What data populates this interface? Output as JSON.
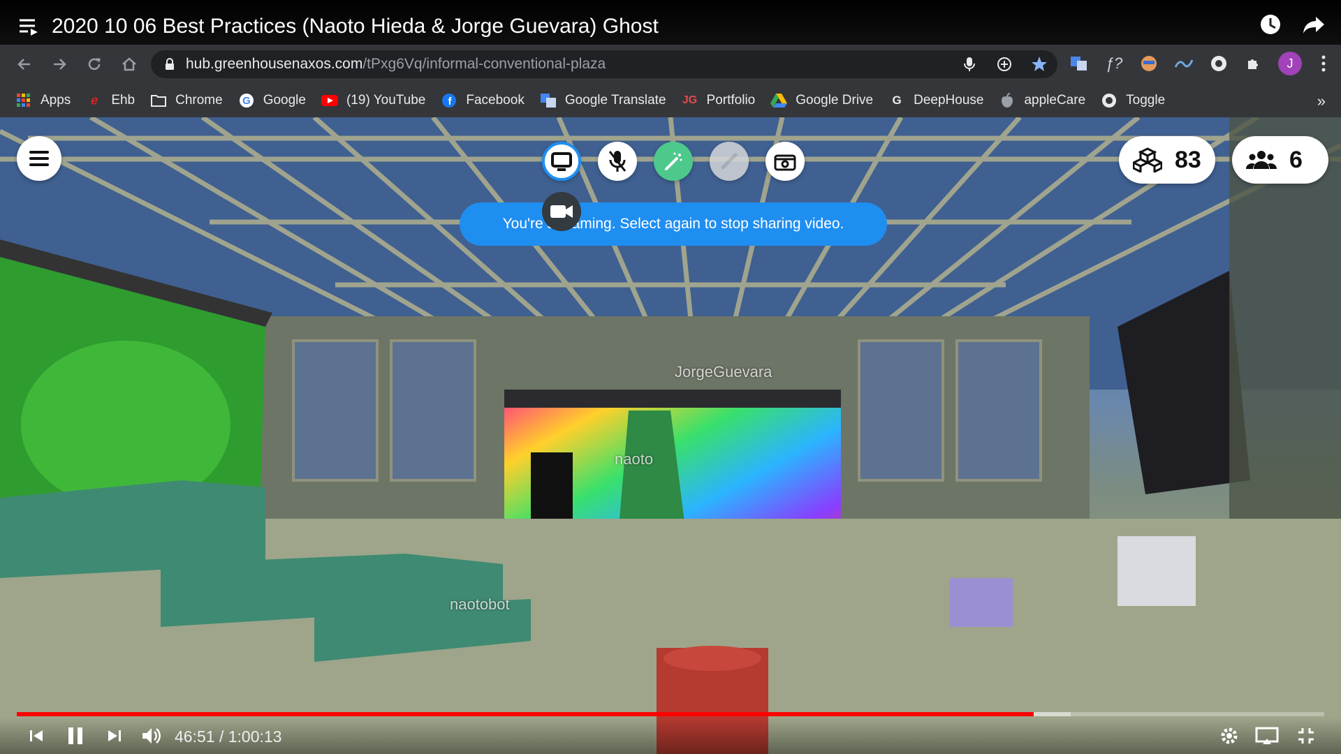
{
  "video": {
    "title": "2020 10 06 Best Practices (Naoto Hieda & Jorge Guevara) Ghost",
    "current_time": "46:51",
    "duration": "1:00:13",
    "time_display": "46:51 / 1:00:13",
    "progress_fraction": 0.778,
    "buffered_fraction": 0.806
  },
  "browser": {
    "url_host": "hub.greenhousenaxos.com",
    "url_path": "/tPxg6Vq/informal-conventional-plaza",
    "avatar_letter": "J"
  },
  "bookmarks": [
    {
      "label": "Apps",
      "icon": "apps-grid-icon"
    },
    {
      "label": "Ehb",
      "icon": "ehb-icon"
    },
    {
      "label": "Chrome",
      "icon": "folder-icon"
    },
    {
      "label": "Google",
      "icon": "google-icon"
    },
    {
      "label": "(19) YouTube",
      "icon": "youtube-icon"
    },
    {
      "label": "Facebook",
      "icon": "facebook-icon"
    },
    {
      "label": "Google Translate",
      "icon": "google-translate-icon"
    },
    {
      "label": "Portfolio",
      "icon": "jg-icon"
    },
    {
      "label": "Google Drive",
      "icon": "google-drive-icon"
    },
    {
      "label": "DeepHouse",
      "icon": "g-icon"
    },
    {
      "label": "appleCare",
      "icon": "apple-icon"
    },
    {
      "label": "Toggle",
      "icon": "toggle-icon"
    }
  ],
  "hubs": {
    "toast": "You're streaming. Select again to stop sharing video.",
    "objects_count": "83",
    "people_count": "6",
    "name_tags": {
      "jorge": "JorgeGuevara",
      "naoto": "naoto",
      "naotobot": "naotobot"
    }
  },
  "colors": {
    "accent_blue": "#1f8ef1",
    "pen_green": "#4ec98c",
    "progress_red": "#ff0000",
    "chrome_bg": "#35363a"
  }
}
